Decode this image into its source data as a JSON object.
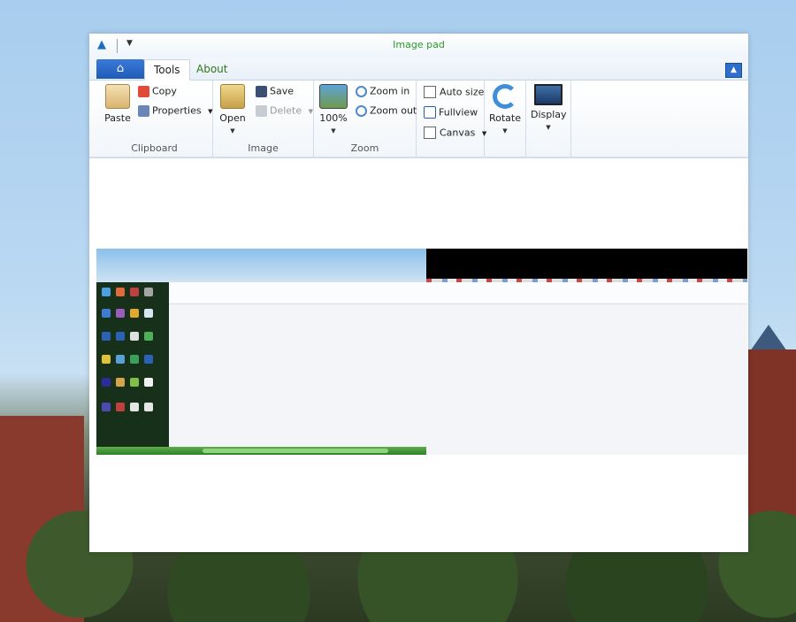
{
  "window": {
    "title": "Image pad",
    "quick_access": {
      "app_icon": "app-logo-icon",
      "dropdown_icon": "chevron-down-icon"
    }
  },
  "tabs": [
    {
      "label": "Tools",
      "active": true
    },
    {
      "label": "About",
      "active": false
    }
  ],
  "home_tab": {
    "icon": "home-icon"
  },
  "ribbon": {
    "clipboard": {
      "label": "Clipboard",
      "paste": "Paste",
      "copy": "Copy",
      "properties": "Properties"
    },
    "image": {
      "label": "Image",
      "open": "Open",
      "save": "Save",
      "delete": "Delete"
    },
    "zoom": {
      "label": "Zoom",
      "percent": "100%",
      "zoom_in": "Zoom in",
      "zoom_out": "Zoom out"
    },
    "view": {
      "auto_size": "Auto size",
      "fullview": "Fullview",
      "canvas": "Canvas"
    },
    "rotate": "Rotate",
    "display": "Display"
  },
  "colors": {
    "title_text": "#2a9a2a",
    "home_tab": "#1f5cb8",
    "accent_blue": "#2f6fcb"
  }
}
